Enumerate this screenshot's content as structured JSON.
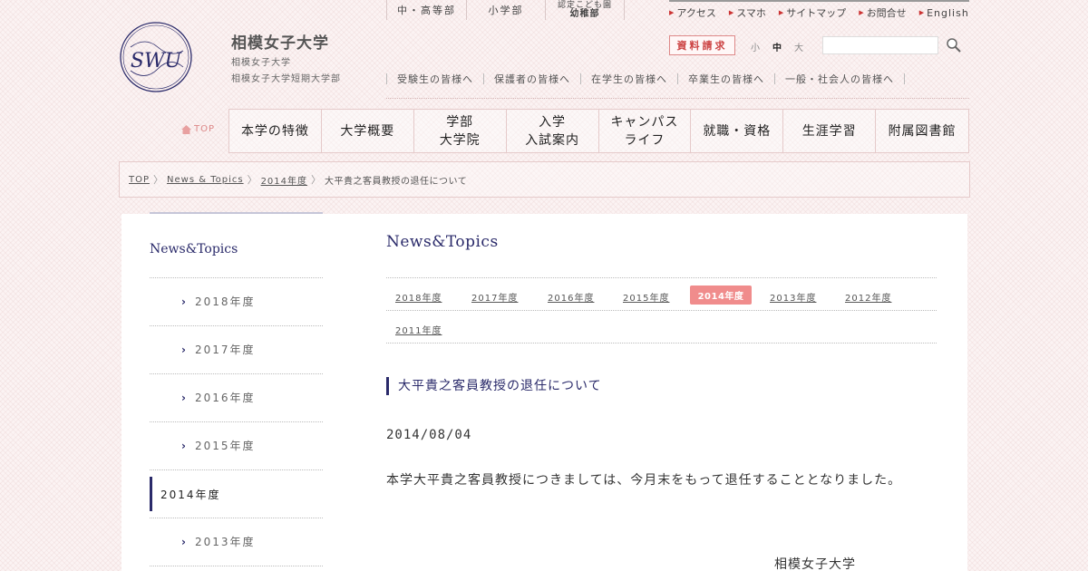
{
  "header": {
    "logo_text": "SWU",
    "university_name": "相模女子大学",
    "sub_line1": "相模女子大学",
    "sub_line2": "相模女子大学短期大学部",
    "school_tabs": {
      "junior_high": "中・高等部",
      "elementary": "小学部",
      "kindergarten_line1": "認定こども園",
      "kindergarten_line2": "幼稚部"
    },
    "util_links": [
      "アクセス",
      "スマホ",
      "サイトマップ",
      "お問合せ",
      "English"
    ],
    "request_button": "資料請求",
    "font_size": {
      "small": "小",
      "medium": "中",
      "large": "大"
    },
    "search": {
      "placeholder": ""
    },
    "audience_links": [
      "受験生の皆様へ",
      "保護者の皆様へ",
      "在学生の皆様へ",
      "卒業生の皆様へ",
      "一般・社会人の皆様へ"
    ]
  },
  "nav": {
    "top_label": "TOP",
    "items": [
      "本学の特徴",
      "大学概要",
      "学部\n大学院",
      "入学\n入試案内",
      "キャンパス\nライフ",
      "就職・資格",
      "生涯学習",
      "附属図書館"
    ]
  },
  "breadcrumb": {
    "items": [
      "TOP",
      "News & Topics",
      "2014年度"
    ],
    "current": "大平貴之客員教授の退任について"
  },
  "sidebar": {
    "title": "News&Topics",
    "items": [
      "2018年度",
      "2017年度",
      "2016年度",
      "2015年度",
      "2014年度",
      "2013年度"
    ],
    "active_index": 4
  },
  "main": {
    "title": "News&Topics",
    "year_tabs": [
      "2018年度",
      "2017年度",
      "2016年度",
      "2015年度",
      "2014年度",
      "2013年度",
      "2012年度",
      "2011年度"
    ],
    "active_year": "2014年度"
  },
  "article": {
    "title": "大平貴之客員教授の退任について",
    "date": "2014/08/04",
    "body": "本学大平貴之客員教授につきましては、今月末をもって退任することとなりました。",
    "signature": "相模女子大学"
  },
  "colors": {
    "accent_navy": "#2a2a6a",
    "accent_pink": "#f08c8c",
    "request_red": "#c44"
  }
}
